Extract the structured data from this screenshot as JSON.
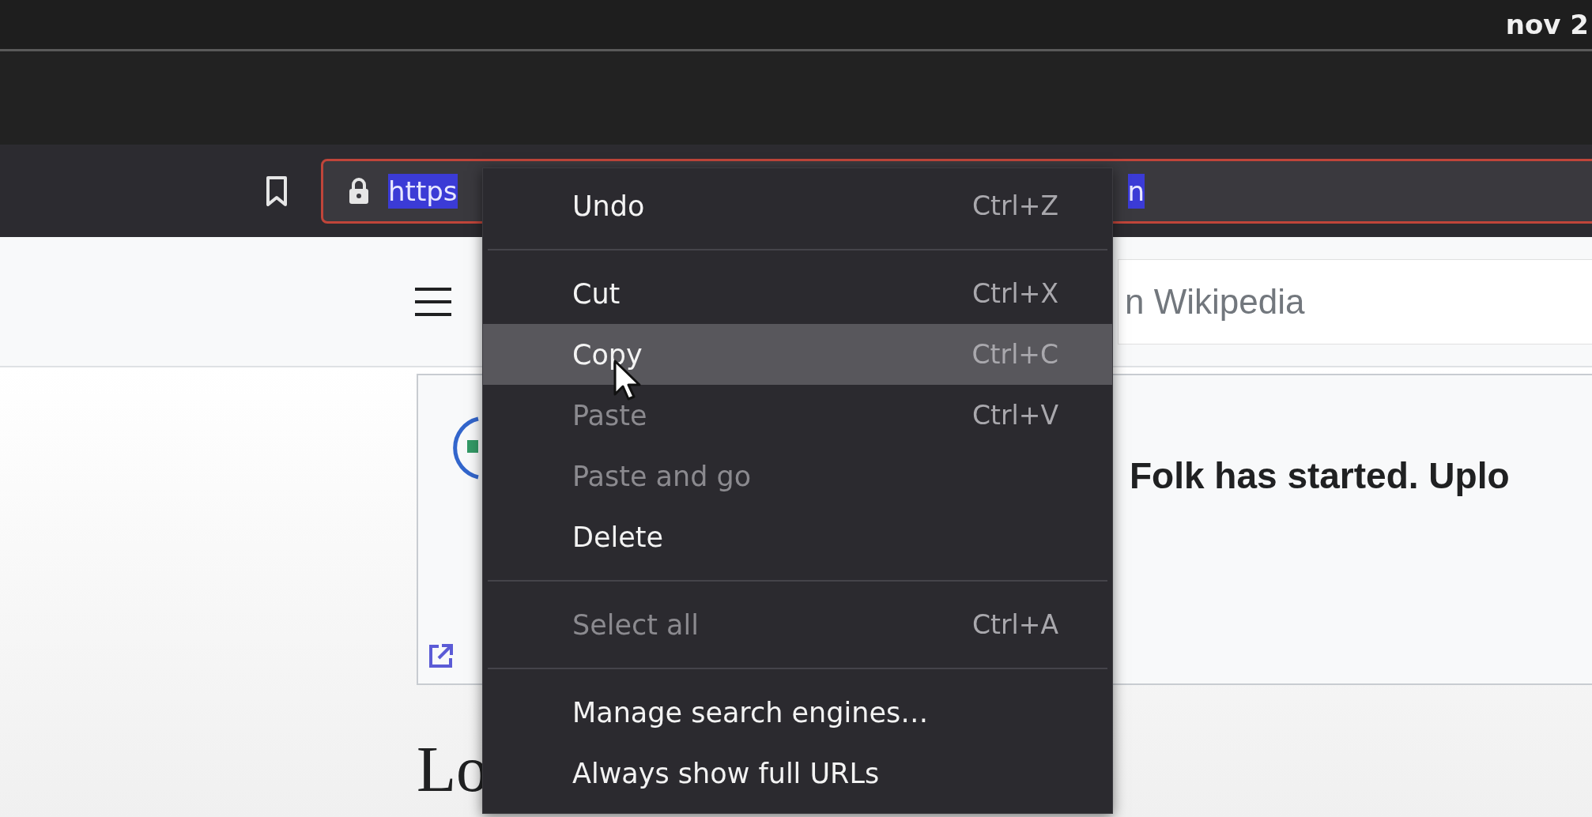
{
  "clock": "nov 2",
  "toolbar": {
    "url_field": {
      "selected_text_start": "https",
      "selected_text_end": "n"
    }
  },
  "page": {
    "search_field": {
      "placeholder": "n Wikipedia"
    },
    "banner": {
      "text": "Folk has started. Uplo"
    },
    "heading": "Lo"
  },
  "context_menu": {
    "items": [
      {
        "kind": "item",
        "label": "Undo",
        "shortcut": "Ctrl+Z",
        "disabled": false,
        "selected": false
      },
      {
        "kind": "separator"
      },
      {
        "kind": "item",
        "label": "Cut",
        "shortcut": "Ctrl+X",
        "disabled": false,
        "selected": false
      },
      {
        "kind": "item",
        "label": "Copy",
        "shortcut": "Ctrl+C",
        "disabled": false,
        "selected": true
      },
      {
        "kind": "item",
        "label": "Paste",
        "shortcut": "Ctrl+V",
        "disabled": true,
        "selected": false
      },
      {
        "kind": "item",
        "label": "Paste and go",
        "disabled": true,
        "selected": false
      },
      {
        "kind": "item",
        "label": "Delete",
        "disabled": false,
        "selected": false
      },
      {
        "kind": "separator"
      },
      {
        "kind": "item",
        "label": "Select all",
        "shortcut": "Ctrl+A",
        "disabled": true,
        "selected": false
      },
      {
        "kind": "separator"
      },
      {
        "kind": "item",
        "label": "Manage search engines…",
        "disabled": false,
        "selected": false
      },
      {
        "kind": "item",
        "label": "Always show full URLs",
        "disabled": false,
        "selected": false
      }
    ]
  }
}
